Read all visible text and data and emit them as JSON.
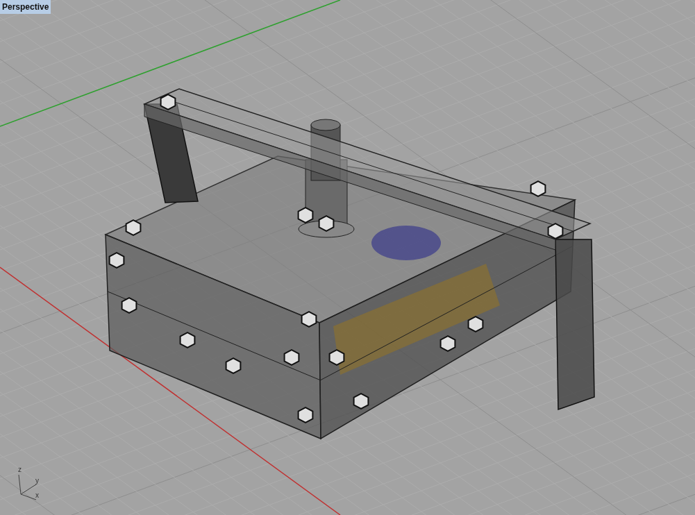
{
  "viewport": {
    "title": "Perspective"
  },
  "axis_gizmo": {
    "labels": [
      "z",
      "y",
      "x"
    ]
  }
}
